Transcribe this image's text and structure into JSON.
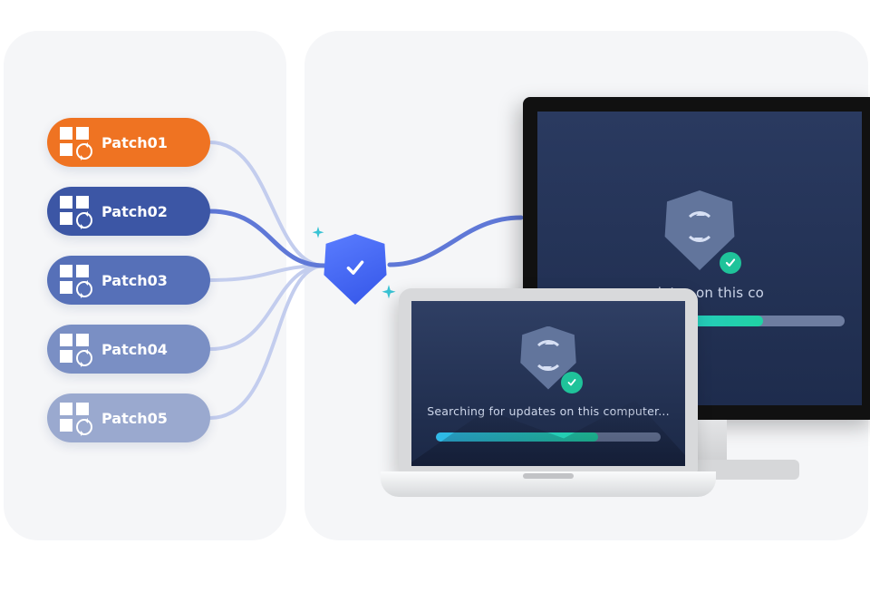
{
  "patches": [
    {
      "label": "Patch01",
      "color": "#ef7322"
    },
    {
      "label": "Patch02",
      "color": "#3c56a5"
    },
    {
      "label": "Patch03",
      "color": "#5670b8"
    },
    {
      "label": "Patch04",
      "color": "#7a8fc4"
    },
    {
      "label": "Patch05",
      "color": "#9aa9cf"
    }
  ],
  "update_message": "Searching for updates on this computer...",
  "monitor_message_visible": "updates on this co",
  "laptop_progress_pct": 72,
  "monitor_progress_pct": 72,
  "colors": {
    "orange": "#ef7322",
    "blue": "#3c56a5",
    "accent": "#20d3a4",
    "shield_gradient_from": "#5a7dff",
    "shield_gradient_to": "#3455e8",
    "panel_bg": "#f5f6f8",
    "wire": "#c3cdee",
    "wire_accent": "#5f78d7"
  }
}
